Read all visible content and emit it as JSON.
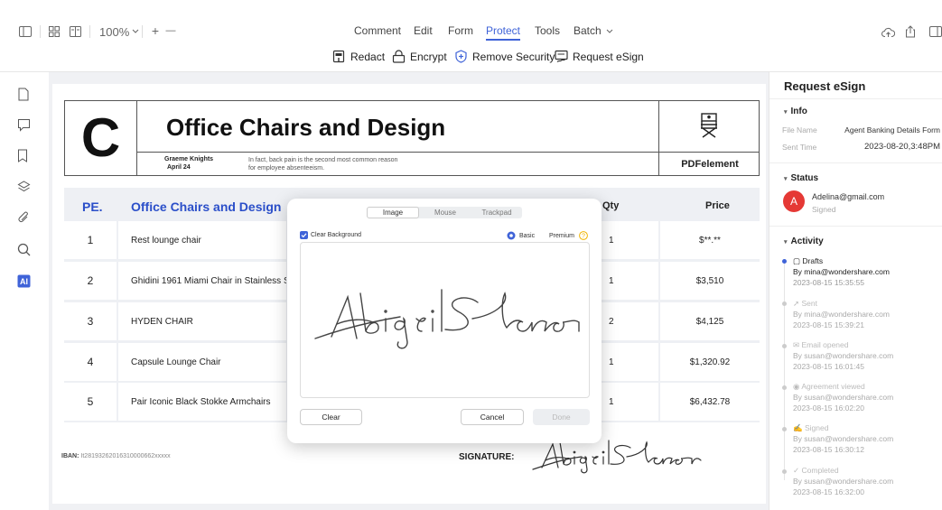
{
  "toolbar": {
    "zoom": "100%",
    "plus": "+",
    "minus": "—",
    "menu_tabs": [
      "Comment",
      "Edit",
      "Form",
      "Protect",
      "Tools",
      "Batch"
    ],
    "active_tab": "Protect",
    "protect_tools": [
      "Redact",
      "Encrypt",
      "Remove Security",
      "Request eSign"
    ]
  },
  "document": {
    "logo_letter": "C",
    "title": "Office Chairs and Design",
    "author": "Graeme Knights",
    "date": "April 24",
    "note_line1": "In fact, back pain is the second most common reason",
    "note_line2": "for employee absenteeism.",
    "brand": "PDFelement",
    "table": {
      "headers": {
        "no": "PE.",
        "item": "Office Chairs and Design",
        "qty": "Qty",
        "price": "Price"
      },
      "rows": [
        {
          "no": "1",
          "item": "Rest lounge chair",
          "qty": "1",
          "price": "$**.**"
        },
        {
          "no": "2",
          "item": "Ghidini 1961 Miami Chair in Stainless S",
          "qty": "1",
          "price": "$3,510"
        },
        {
          "no": "3",
          "item": "HYDEN CHAIR",
          "qty": "2",
          "price": "$4,125"
        },
        {
          "no": "4",
          "item": "Capsule Lounge Chair",
          "qty": "1",
          "price": "$1,320.92"
        },
        {
          "no": "5",
          "item": "Pair Iconic Black Stokke Armchairs",
          "qty": "1",
          "price": "$6,432.78"
        }
      ]
    },
    "iban_label": "IBAN:",
    "iban_value": "It28193262016310000662xxxxx",
    "signature_label": "SIGNATURE:"
  },
  "signature_dialog": {
    "tabs": [
      "Image",
      "Mouse",
      "Trackpad"
    ],
    "active_tab": "Image",
    "clear_background_label": "Clear Background",
    "clear_background_checked": true,
    "mode_basic": "Basic",
    "mode_premium": "Premium",
    "clear_button": "Clear",
    "cancel_button": "Cancel",
    "done_button": "Done"
  },
  "request_panel": {
    "title": "Request eSign",
    "info_heading": "Info",
    "file_name_label": "File Name",
    "file_name_value": "Agent Banking Details Form",
    "sent_time_label": "Sent Time",
    "sent_time_value": "2023-08-20,3:48PM",
    "status_heading": "Status",
    "signer_initial": "A",
    "signer_email": "Adelina@gmail.com",
    "signer_status": "Signed",
    "activity_heading": "Activity",
    "activities": [
      {
        "title": "Drafts",
        "by": "By mina@wondershare.com",
        "time": "2023-08-15 15:35:55"
      },
      {
        "title": "Sent",
        "by": "By mina@wondershare.com",
        "time": "2023-08-15 15:39:21"
      },
      {
        "title": "Email opened",
        "by": "By susan@wondershare.com",
        "time": "2023-08-15 16:01:45"
      },
      {
        "title": "Agreement viewed",
        "by": "By susan@wondershare.com",
        "time": "2023-08-15 16:02:20"
      },
      {
        "title": "Signed",
        "by": "By susan@wondershare.com",
        "time": "2023-08-15 16:30:12"
      },
      {
        "title": "Completed",
        "by": "By susan@wondershare.com",
        "time": "2023-08-15 16:32:00"
      }
    ]
  },
  "colors": {
    "accent": "#3f63d8",
    "avatar": "#e53935",
    "table_bg": "#eef0f4"
  }
}
